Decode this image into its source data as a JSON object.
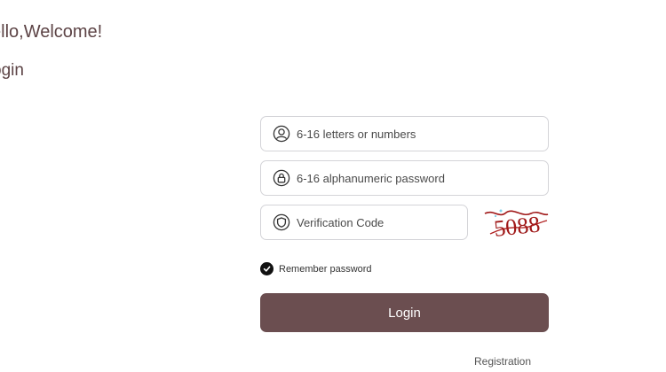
{
  "header": {
    "greeting": "ello,Welcome!",
    "subtitle": "ogin"
  },
  "form": {
    "username": {
      "placeholder": "6-16 letters or numbers",
      "value": "",
      "icon": "user-icon"
    },
    "password": {
      "placeholder": "6-16 alphanumeric password",
      "value": "",
      "icon": "lock-icon"
    },
    "verification": {
      "placeholder": "Verification Code",
      "value": "",
      "icon": "shield-icon",
      "captcha_text": "5088"
    },
    "remember": {
      "label": "Remember password",
      "checked": true
    },
    "login_label": "Login",
    "registration_label": "Registration"
  },
  "colors": {
    "accent": "#6b4e50",
    "heading": "#5d4446",
    "captcha": "#a01818"
  }
}
